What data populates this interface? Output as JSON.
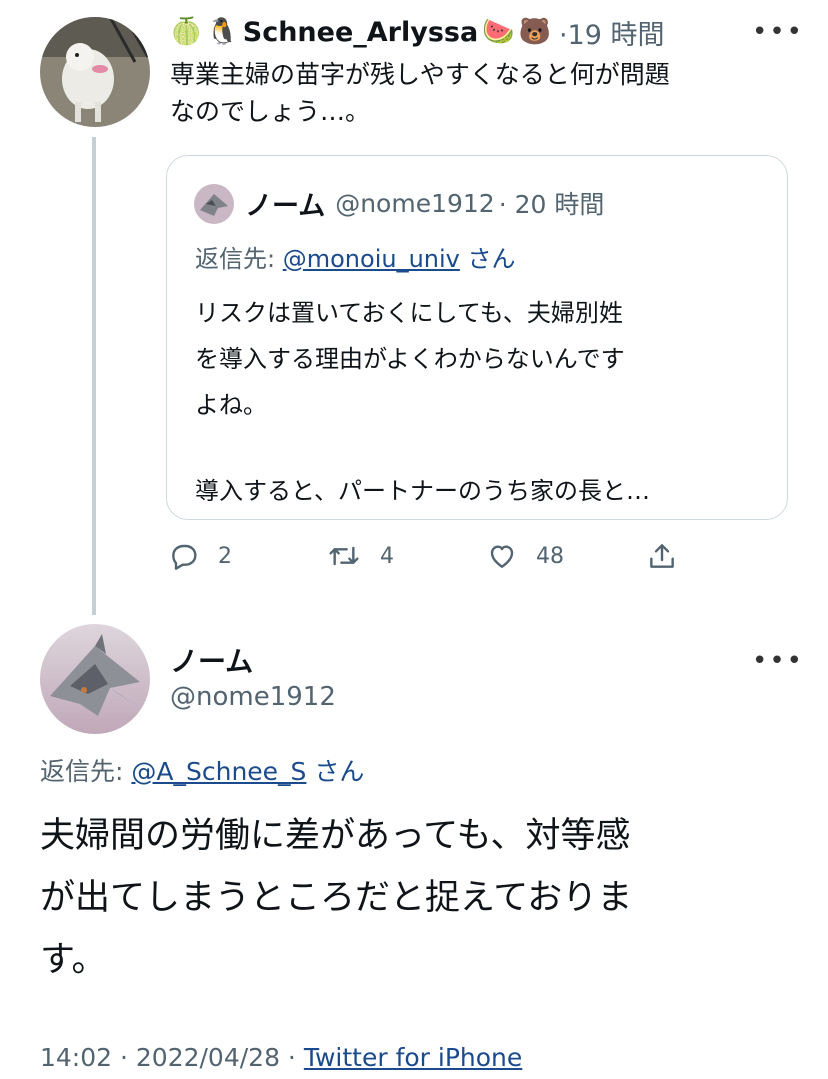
{
  "first_tweet": {
    "emojis_before": [
      "🍈",
      "🐧"
    ],
    "display_name": "Schnee_Arlyssa",
    "emojis_after": [
      "🍉",
      "🐻"
    ],
    "time": "·19 時間",
    "text_line1": "専業主婦の苗字が残しやすくなると何が問題",
    "text_line2": "なのでしょう…。",
    "more_icon": "more-dots-icon"
  },
  "quoted_tweet": {
    "display_name": "ノーム",
    "handle": "@nome1912",
    "time": "· 20 時間",
    "reply_prefix": "返信先:",
    "reply_handle": "@monoiu_univ",
    "reply_suffix": "さん",
    "text_line1": "リスクは置いておくにしても、夫婦別姓",
    "text_line2": "を導入する理由がよくわからないんです",
    "text_line3": "よね。",
    "text_line4": "導入すると、パートナーのうち家の長と…"
  },
  "actions": {
    "reply_count": "2",
    "retweet_count": "4",
    "like_count": "48",
    "icons": [
      "reply-icon",
      "retweet-icon",
      "like-icon",
      "share-icon"
    ]
  },
  "main_tweet": {
    "display_name": "ノーム",
    "handle": "@nome1912",
    "reply_prefix": "返信先:",
    "reply_handle": "@A_Schnee_S",
    "reply_suffix": "さん",
    "text_line1": "夫婦間の労働に差があっても、対等感",
    "text_line2": "が出てしまうところだと捉えておりま",
    "text_line3": "す。",
    "date": "14:02 · 2022/04/28 ·",
    "client": "Twitter for iPhone"
  }
}
